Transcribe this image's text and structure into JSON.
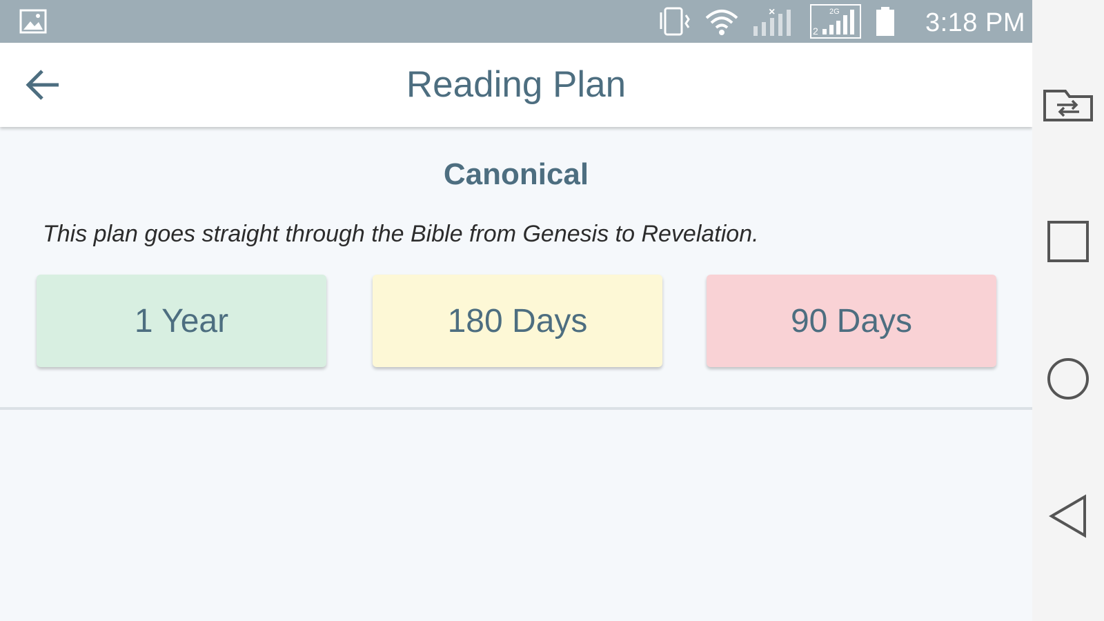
{
  "status_bar": {
    "time": "3:18 PM",
    "network_label": "2G",
    "sim_label": "2",
    "icons": [
      "gallery-icon",
      "vibrate-icon",
      "wifi-icon",
      "signal-no-service-icon",
      "signal-2g-icon",
      "battery-icon"
    ]
  },
  "app_bar": {
    "title": "Reading Plan",
    "back_icon": "arrow-back-icon"
  },
  "plan": {
    "name": "Canonical",
    "description": "This plan goes straight through the Bible from Genesis to Revelation.",
    "options": [
      {
        "label": "1 Year",
        "color": "#d8efe1"
      },
      {
        "label": "180 Days",
        "color": "#fdf8d6"
      },
      {
        "label": "90 Days",
        "color": "#f9d2d5"
      }
    ]
  },
  "nav_bar": {
    "icons": [
      "screen-switch-icon",
      "recent-apps-icon",
      "home-icon",
      "back-icon"
    ]
  },
  "colors": {
    "status_bar": "#9dadb6",
    "accent_text": "#4d6e80",
    "background": "#f5f8fb"
  }
}
